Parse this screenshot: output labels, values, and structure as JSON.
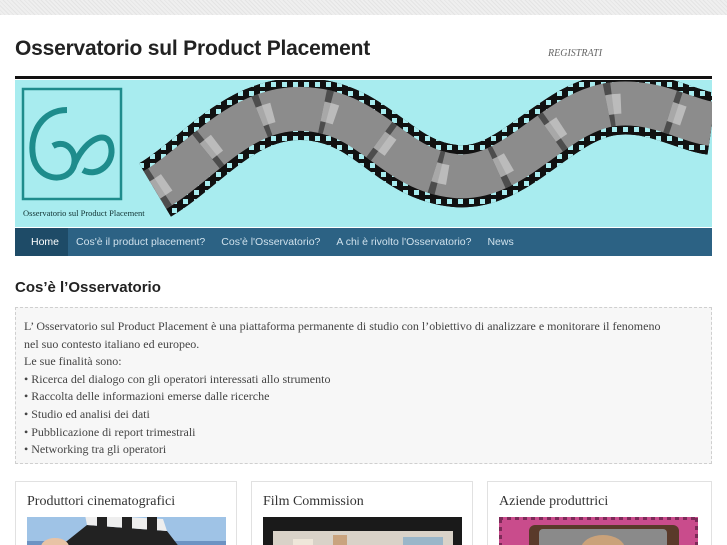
{
  "header": {
    "site_title": "Osservatorio sul Product Placement",
    "register_label": "REGISTRATI"
  },
  "banner": {
    "logo_caption": "Osservatorio sul Product Placement",
    "colors": {
      "background": "#a8ecef",
      "logo_teal": "#1e8c8c",
      "film": "#111111"
    }
  },
  "nav": {
    "items": [
      {
        "label": "Home",
        "active": true
      },
      {
        "label": "Cos'è il product placement?"
      },
      {
        "label": "Cos'è l'Osservatorio?"
      },
      {
        "label": "A chi è rivolto l'Osservatorio?"
      },
      {
        "label": "News"
      }
    ],
    "colors": {
      "bar": "#2c6284",
      "active": "#1e4b67"
    }
  },
  "main": {
    "title": "Cos’è l’Osservatorio",
    "lines": [
      "L’ Osservatorio sul Product Placement è una piattaforma permanente di studio con l’obiettivo di analizzare e monitorare il fenomeno",
      "nel suo contesto italiano ed europeo.",
      "Le sue finalità sono:",
      "• Ricerca del dialogo con gli operatori interessati allo strumento",
      "• Raccolta delle informazioni emerse dalle ricerche",
      "• Studio ed analisi dei dati",
      "• Pubblicazione di report trimestrali",
      "• Networking tra gli operatori"
    ]
  },
  "cards": [
    {
      "title": "Produttori cinematografici"
    },
    {
      "title": "Film Commission"
    },
    {
      "title": "Aziende produttrici"
    }
  ]
}
